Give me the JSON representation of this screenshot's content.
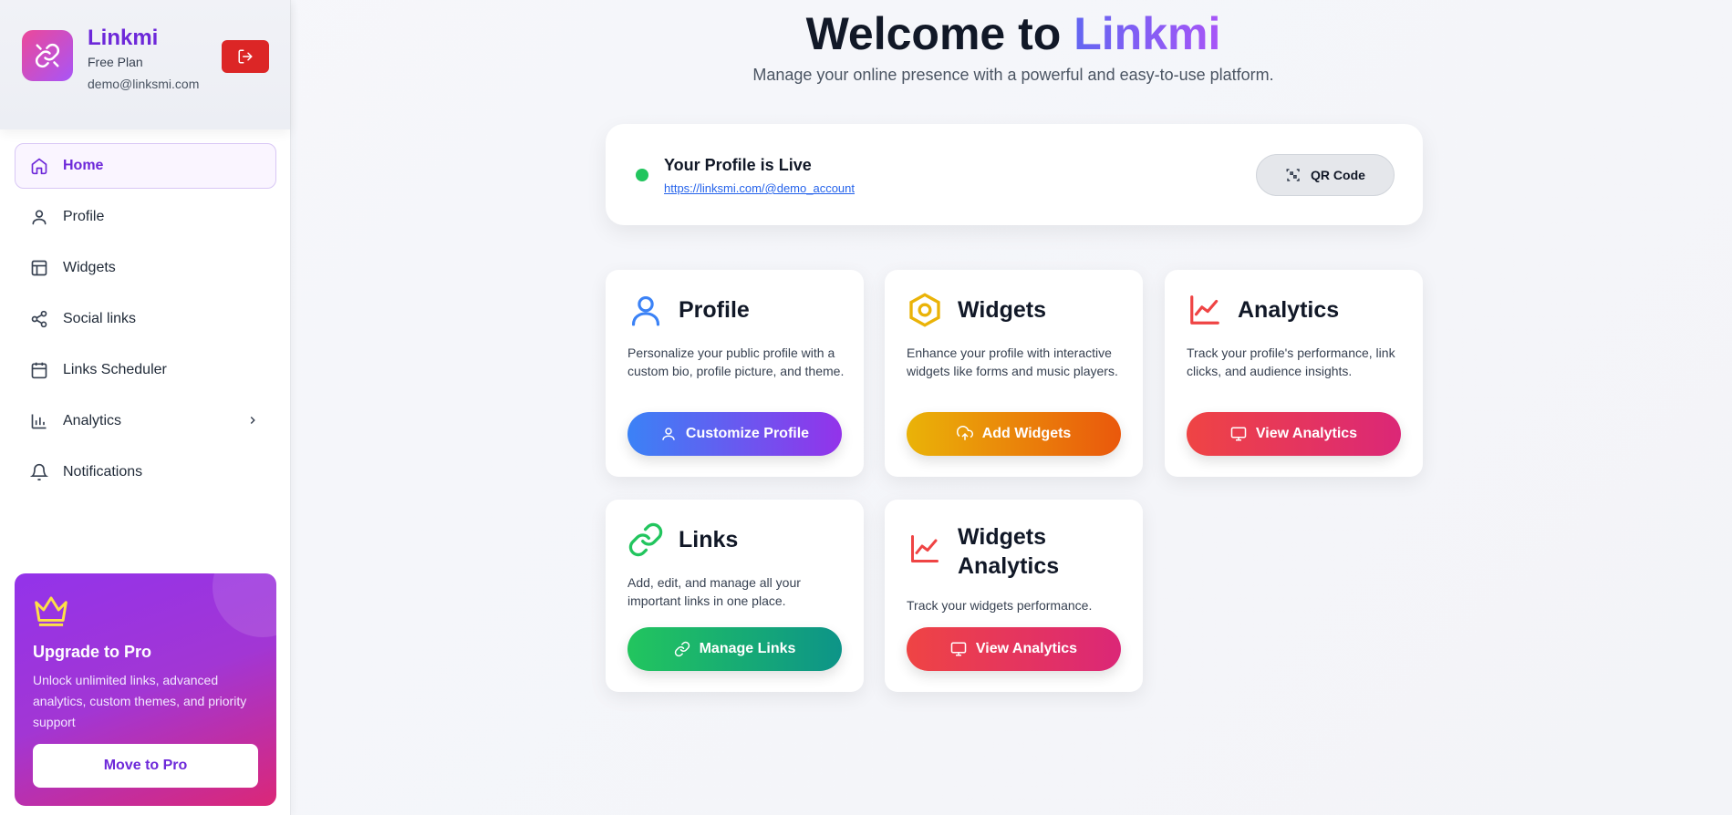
{
  "sidebar": {
    "brand": "Linkmi",
    "plan": "Free Plan",
    "email": "demo@linksmi.com",
    "nav": [
      {
        "label": "Home",
        "icon": "home-icon"
      },
      {
        "label": "Profile",
        "icon": "user-icon"
      },
      {
        "label": "Widgets",
        "icon": "layout-icon"
      },
      {
        "label": "Social links",
        "icon": "share-icon"
      },
      {
        "label": "Links Scheduler",
        "icon": "calendar-icon"
      },
      {
        "label": "Analytics",
        "icon": "bar-chart-icon"
      },
      {
        "label": "Notifications",
        "icon": "bell-icon"
      }
    ],
    "upgrade": {
      "title": "Upgrade to Pro",
      "description": "Unlock unlimited links, advanced analytics, custom themes, and priority support",
      "button": "Move to Pro"
    }
  },
  "main": {
    "title_prefix": "Welcome to ",
    "title_brand": "Linkmi",
    "subtitle": "Manage your online presence with a powerful and easy-to-use platform.",
    "live": {
      "title": "Your Profile is Live",
      "url": "https://linksmi.com/@demo_account",
      "qr_button": "QR Code"
    },
    "cards": [
      {
        "title": "Profile",
        "description": "Personalize your public profile with a custom bio, profile picture, and theme.",
        "button": "Customize Profile"
      },
      {
        "title": "Widgets",
        "description": "Enhance your profile with interactive widgets like forms and music players.",
        "button": "Add Widgets"
      },
      {
        "title": "Analytics",
        "description": "Track your profile's performance, link clicks, and audience insights.",
        "button": "View Analytics"
      },
      {
        "title": "Links",
        "description": "Add, edit, and manage all your important links in one place.",
        "button": "Manage Links"
      },
      {
        "title": "Widgets Analytics",
        "description": "Track your widgets performance.",
        "button": "View Analytics"
      }
    ]
  },
  "colors": {
    "accent": "#6d28d9",
    "live": "#22c55e",
    "danger": "#dc2626"
  }
}
